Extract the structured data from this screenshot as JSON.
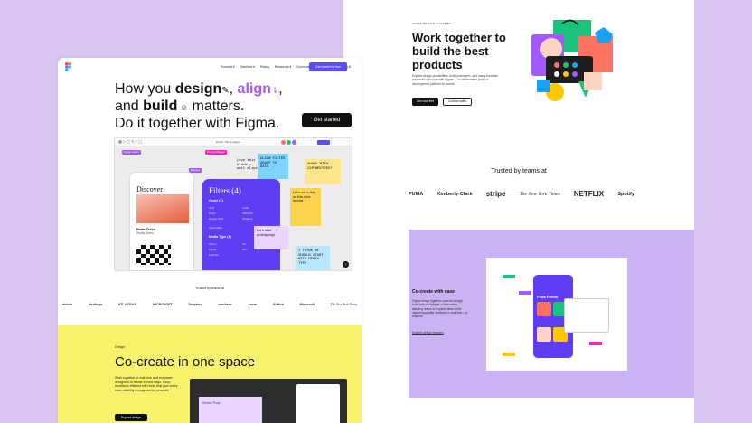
{
  "back_page": {
    "small_label": "FIGMA DESIGN SYSTEMS",
    "headline": "Work together to build the best products",
    "description": "Explore design possibilities, build prototypes, and easily translate your work into code with Figma — a collaborative product development platform for teams.",
    "primary_button": "Join now free",
    "secondary_button": "Contact sales",
    "trusted_label": "Trusted by teams at",
    "logos": [
      "PUMA",
      "Kimberly-Clark",
      "stripe",
      "The New York Times",
      "NETFLIX",
      "Spotify"
    ],
    "co_title": "Co-create with ease",
    "co_description": "Figma brings together powerful design tools with multiplayer collaboration, allowing teams to explore ideas while capturing quality feedback in real time—or anytime.",
    "co_link": "Explore design features",
    "card_title": "Flora Forms"
  },
  "front_page": {
    "nav": {
      "items": [
        "Products ▾",
        "Solutions ▾",
        "Pricing",
        "Resources ▾",
        "Community ▾",
        "Contact sales",
        "Log in"
      ],
      "cta": "Get started for free"
    },
    "hero": {
      "line1_a": "How you ",
      "line1_b": "design",
      "line1_c": ", ",
      "line1_d": "align",
      "line1_e": ",",
      "line2_a": "and ",
      "line2_b": "build",
      "line2_c": " matters.",
      "line3": "Do it together with Figma.",
      "button": "Get started"
    },
    "editor": {
      "file_name": "Drafts / Shop pages",
      "phone1": {
        "title": "Discover",
        "item_name": "Palm Trees",
        "item_sub": "Shelly Griest"
      },
      "phone2": {
        "title": "Filters (4)",
        "section1": "Genre (1)",
        "genre_options": [
          "Arch",
          "Photo",
          "Design Grid",
          "Color",
          "Still Pink",
          "All items"
        ],
        "show_more": "Show More",
        "section2": "Media Type (3)",
        "media_options": [
          "Album",
          "Figma",
          "Podcast",
          "Art",
          "Mix"
        ]
      },
      "stickies": [
        "Love this blurb — wait align",
        "ALLOW FILTER GROUP TO DATA",
        "SHARE WITH COPYWRITERS?",
        "Let's run a test on this new format",
        "Let's start prototyping!",
        "I THINK WE SHOULD START WITH MEDIA TYPE"
      ],
      "tags": [
        "Design Leader",
        "Product Manager",
        "Designer",
        "Engineer"
      ]
    },
    "trusted_label": "Trusted by teams at",
    "logos": [
      "airbnb",
      "duolingo",
      "ATLASSIAN",
      "MICROSOFT",
      "Dropbox",
      "coinbase",
      "zoom",
      "GitHub",
      "Microsoft",
      "The New York Times"
    ],
    "yellow": {
      "eyebrow": "Design",
      "heading": "Co-create in one space",
      "description": "Work together in real time and empower designers to create in new ways. Keep workflows efficient with tools that give every team visibility throughout the process.",
      "button": "Explore design",
      "window_label": "World Post"
    }
  },
  "colors": {
    "background": "#d9c6f0",
    "figma_purple": "#a259ff",
    "cta_blue": "#5b4dff",
    "yellow_section": "#f8f16b",
    "lavender_section": "#c9b3f2"
  }
}
